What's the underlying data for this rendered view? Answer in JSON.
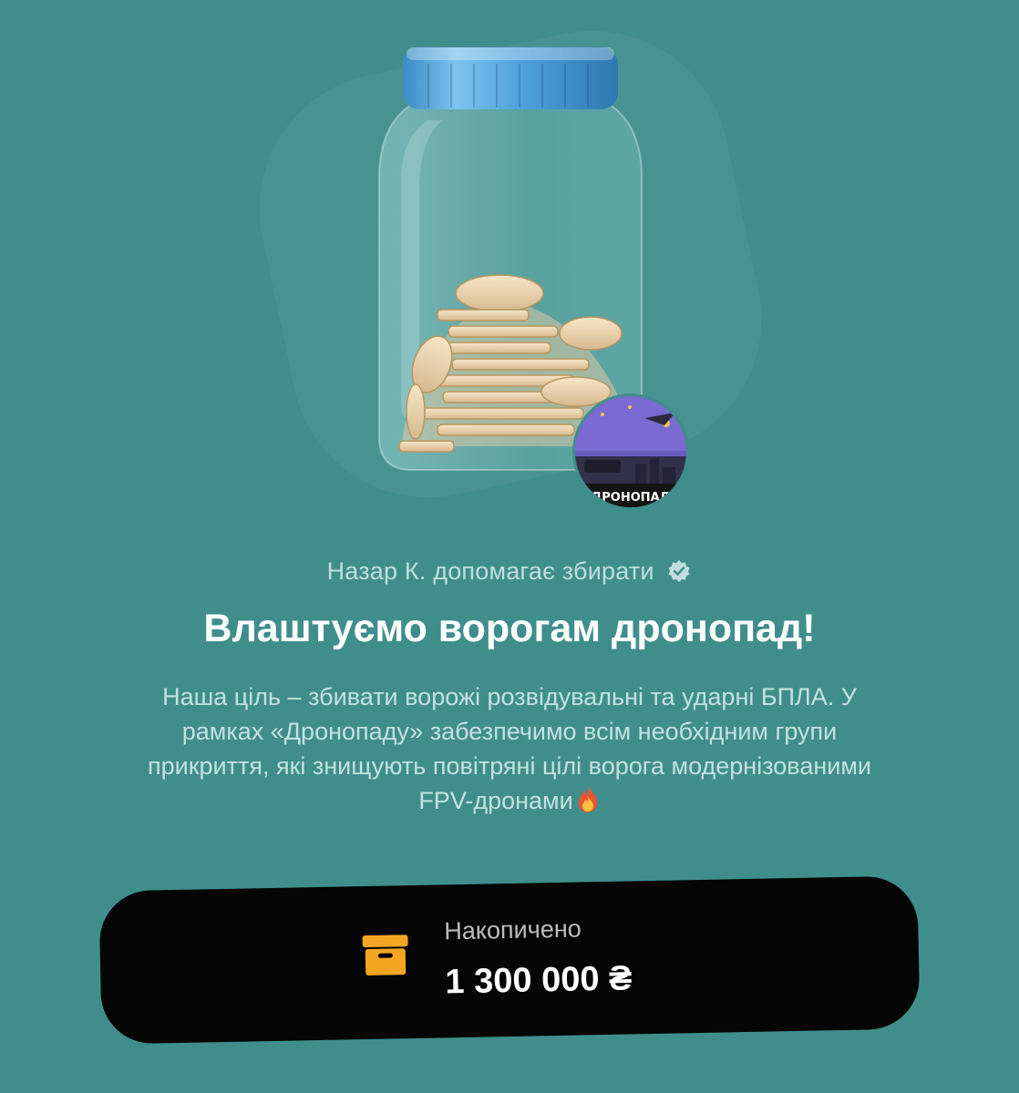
{
  "jar": {
    "image": "jar-with-coins",
    "avatar": "dronopad-avatar",
    "avatar_text": "ДРОНОПАД"
  },
  "helper": {
    "text": "Назар К. допомагає збирати",
    "verified_icon": "verified-check-icon"
  },
  "title": "Влаштуємо ворогам дронопад!",
  "description": {
    "text": "Наша ціль – збивати ворожі розвідувальні та ударні БПЛА. У рамках «Дронопаду» забезпечимо всім необхідним групи прикриття, які знищують повітряні цілі ворога модернізованими FPV-дронами",
    "emoji": "fire-emoji"
  },
  "accumulated": {
    "label": "Накопичено",
    "amount": "1 300 000 ₴",
    "icon": "archive-box-icon",
    "icon_color": "#f5a524"
  },
  "colors": {
    "background": "#3f8e8c",
    "card": "#050505",
    "lid": "#4a9fd8"
  }
}
